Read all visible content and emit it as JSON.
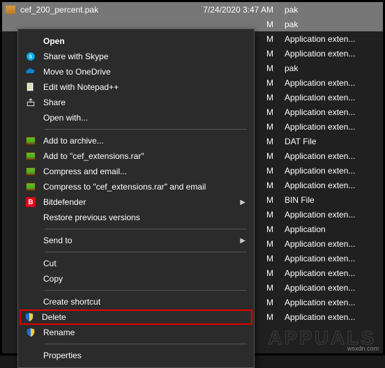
{
  "selected_file": {
    "name": "cef_200_percent.pak",
    "date": "7/24/2020 3:47 AM",
    "type": "pak"
  },
  "visible_rows": [
    {
      "date_tail": "M",
      "type": "pak",
      "selected": true
    },
    {
      "date_tail": "M",
      "type": "Application exten..."
    },
    {
      "date_tail": "M",
      "type": "Application exten..."
    },
    {
      "date_tail": "M",
      "type": "pak"
    },
    {
      "date_tail": "M",
      "type": "Application exten..."
    },
    {
      "date_tail": "M",
      "type": "Application exten..."
    },
    {
      "date_tail": "M",
      "type": "Application exten..."
    },
    {
      "date_tail": "M",
      "type": "Application exten..."
    },
    {
      "date_tail": "M",
      "type": "DAT File"
    },
    {
      "date_tail": "M",
      "type": "Application exten..."
    },
    {
      "date_tail": "M",
      "type": "Application exten..."
    },
    {
      "date_tail": "M",
      "type": "Application exten..."
    },
    {
      "date_tail": "M",
      "type": "BIN File"
    },
    {
      "date_tail": "M",
      "type": "Application exten..."
    },
    {
      "date_tail": "M",
      "type": "Application"
    },
    {
      "date_tail": "M",
      "type": "Application exten..."
    },
    {
      "date_tail": "M",
      "type": "Application exten..."
    },
    {
      "date_tail": "M",
      "type": "Application exten..."
    },
    {
      "date_tail": "M",
      "type": "Application exten..."
    },
    {
      "date_tail": "M",
      "type": "Application exten..."
    },
    {
      "date_tail": "M",
      "type": "Application exten..."
    }
  ],
  "menu": {
    "open": "Open",
    "skype": "Share with Skype",
    "onedrive": "Move to OneDrive",
    "notepad": "Edit with Notepad++",
    "share": "Share",
    "openwith": "Open with...",
    "archive_add": "Add to archive...",
    "archive_addto": "Add to \"cef_extensions.rar\"",
    "archive_email": "Compress and email...",
    "archive_toemail": "Compress to \"cef_extensions.rar\" and email",
    "bitdefender": "Bitdefender",
    "restore": "Restore previous versions",
    "sendto": "Send to",
    "cut": "Cut",
    "copy": "Copy",
    "shortcut": "Create shortcut",
    "delete": "Delete",
    "rename": "Rename",
    "properties": "Properties"
  },
  "watermark": "APPUALS",
  "brand": "wsxdn.com"
}
